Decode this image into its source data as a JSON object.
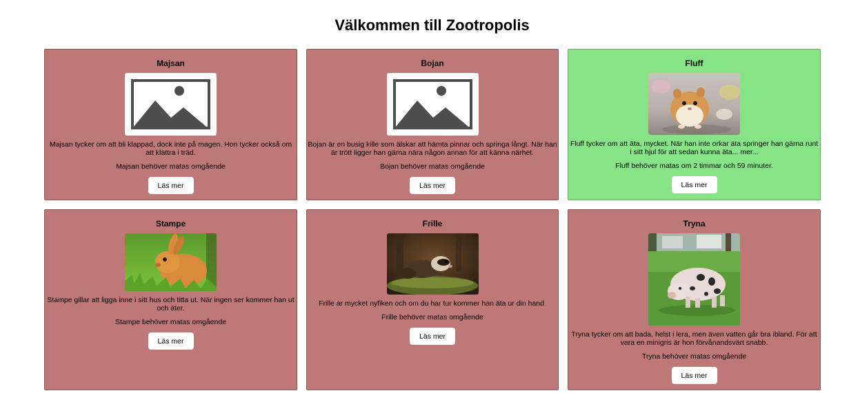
{
  "page": {
    "title": "Välkommen till Zootropolis"
  },
  "animals": [
    {
      "name": "Majsan",
      "image": "placeholder-image-icon",
      "description": "Majsan tycker om att bli klappad, dock inte på magen. Hon tycker också om att klättra i träd.",
      "feed_status": "Majsan behöver matas omgående",
      "button_label": "Läs mer",
      "status_color": "#bf7878"
    },
    {
      "name": "Bojan",
      "image": "placeholder-image-icon",
      "description": "Bojan är en busig kille som älskar att hämta pinnar och springa långt. När han är trött ligger han gärna nära någon annan för att känna närhet.",
      "feed_status": "Bojan behöver matas omgående",
      "button_label": "Läs mer",
      "status_color": "#bf7878"
    },
    {
      "name": "Fluff",
      "image": "hamster-photo",
      "description": "Fluff tycker om att äta, mycket. När han inte orkar äta springer han gärna runt i sitt hjul för att sedan kunna äta... mer...",
      "feed_status": "Fluff behöver matas om 2 timmar och 59 minuter.",
      "button_label": "Läs mer",
      "status_color": "#86e486"
    },
    {
      "name": "Stampe",
      "image": "rabbit-photo",
      "description": "Stampe gillar att ligga inne i sitt hus och titta ut. När ingen ser kommer han ut och äter.",
      "feed_status": "Stampe behöver matas omgående",
      "button_label": "Läs mer",
      "status_color": "#bf7878"
    },
    {
      "name": "Frille",
      "image": "ferret-photo",
      "description": "Frille är mycket nyfiken och om du har tur kommer han äta ur din hand.",
      "feed_status": "Frille behöver matas omgående",
      "button_label": "Läs mer",
      "status_color": "#bf7878"
    },
    {
      "name": "Tryna",
      "image": "pig-photo",
      "description": "Tryna tycker om att bada, helst i lera, men även vatten går bra ibland. För att vara en minigris är hon förvånandsvärt snabb.",
      "feed_status": "Tryna behöver matas omgående",
      "button_label": "Läs mer",
      "status_color": "#bf7878"
    }
  ]
}
